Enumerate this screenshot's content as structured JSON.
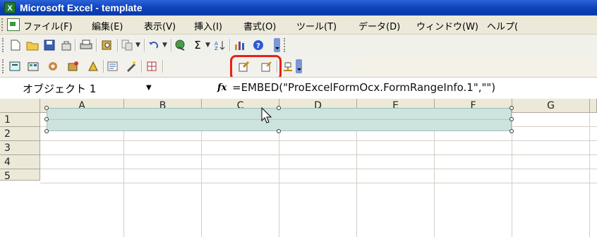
{
  "titlebar": {
    "title": "Microsoft Excel - template",
    "app_icon": "excel-icon"
  },
  "menubar": {
    "items": [
      "ファイル(F)",
      "編集(E)",
      "表示(V)",
      "挿入(I)",
      "書式(O)",
      "ツール(T)",
      "データ(D)",
      "ウィンドウ(W)",
      "ヘルプ("
    ]
  },
  "formulabar": {
    "name_box": "オブジェクト 1",
    "fx_label": "fx",
    "formula": "=EMBED(\"ProExcelFormOcx.FormRangeInfo.1\",\"\")"
  },
  "grid": {
    "columns": [
      "A",
      "B",
      "C",
      "D",
      "E",
      "F",
      "G"
    ],
    "rows": [
      "1",
      "2",
      "3",
      "4",
      "5"
    ]
  },
  "colors": {
    "highlight": "#e8201a",
    "selection_fill": "#cde3de",
    "title_bg": "#0b40b8"
  }
}
